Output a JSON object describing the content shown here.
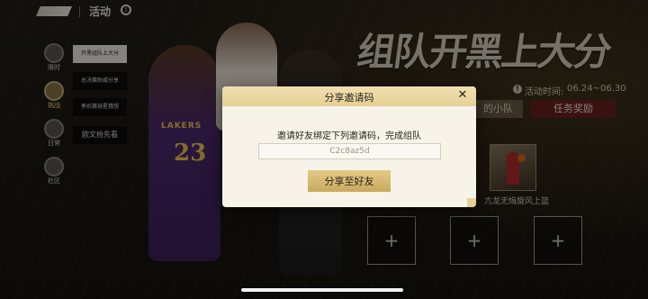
{
  "topbar": {
    "title": "活动",
    "icon": "info-circle-icon"
  },
  "banner": {
    "title": "组队开黑上大分",
    "jersey_name": "LAKERS",
    "jersey_number": "23",
    "time_label": "活动时间:",
    "time_value": "06.24~06.30",
    "team_tab": "的小队",
    "reward_tab": "任务奖励",
    "reward_name": "亢龙无悔旋风上篮"
  },
  "sidebar": {
    "items": [
      {
        "label": "限时",
        "icon": "clock-icon"
      },
      {
        "label": "挑战",
        "icon": "medal-icon",
        "active": true
      },
      {
        "label": "日常",
        "icon": "calendar-icon"
      },
      {
        "label": "社区",
        "icon": "community-icon"
      }
    ]
  },
  "submenu": {
    "items": [
      {
        "label": "开黑组队上大分",
        "active": true
      },
      {
        "label": "总决赛助威分享"
      },
      {
        "label": "季后赛球星猜想"
      },
      {
        "label": "欧文抢先看"
      }
    ]
  },
  "team_slots": [
    "+",
    "+",
    "+"
  ],
  "modal": {
    "title": "分享邀请码",
    "close": "✕",
    "description": "邀请好友绑定下列邀请码，完成组队",
    "code": "C2c8az5d",
    "share_button": "分享至好友"
  },
  "colors": {
    "accent_gold": "#e3c986",
    "reward_red": "#6b1f1f"
  }
}
